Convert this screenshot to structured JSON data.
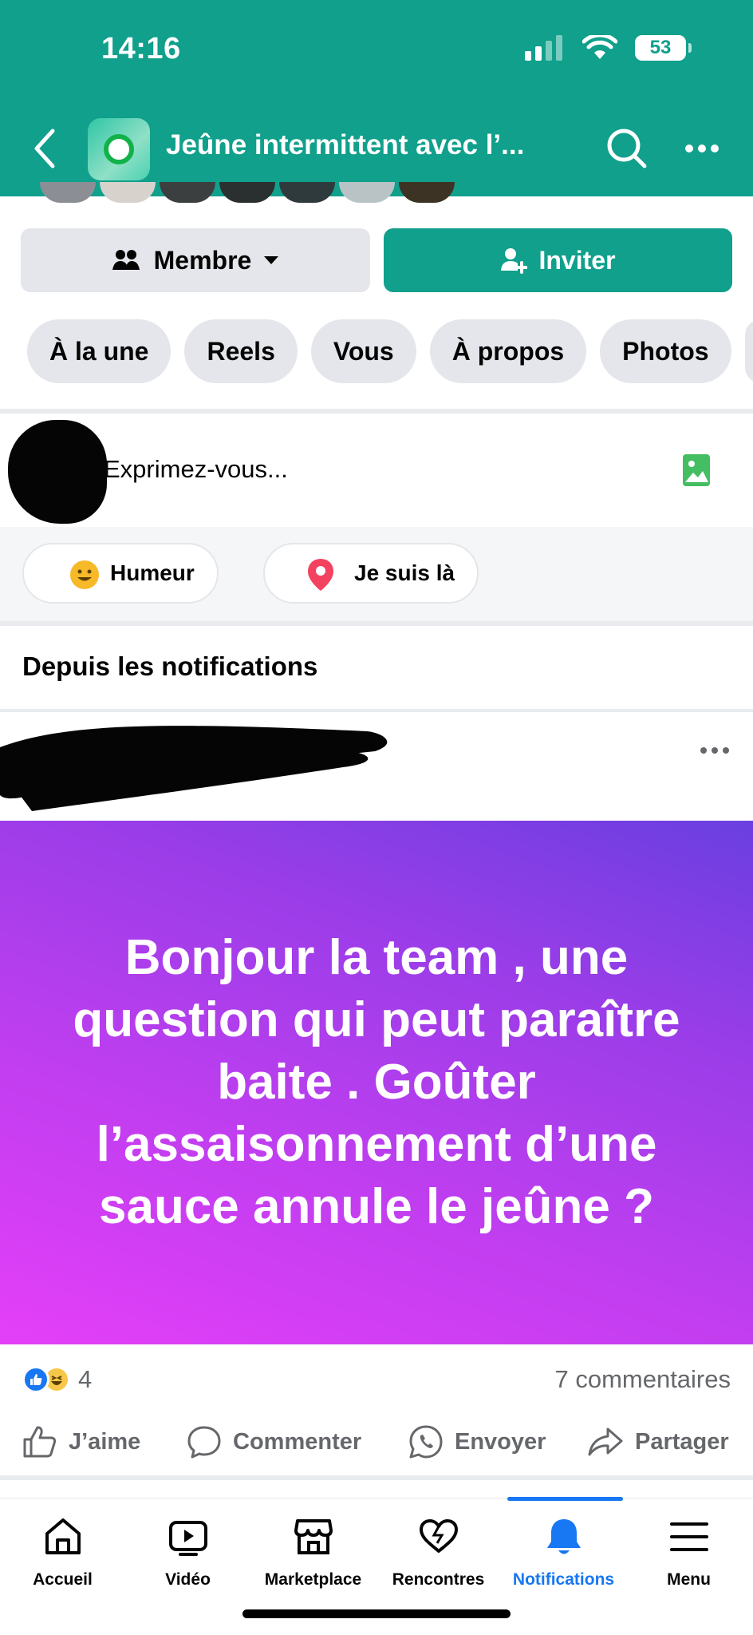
{
  "status_bar": {
    "time": "14:16",
    "battery": "53",
    "icons": [
      "signal-icon",
      "wifi-icon",
      "battery-icon"
    ]
  },
  "header": {
    "title": "Jeûne intermittent avec l’...",
    "back_icon": "chevron-left-icon",
    "search_icon": "search-icon",
    "more_icon": "more-icon"
  },
  "actions": {
    "member_label": "Membre",
    "invite_label": "Inviter"
  },
  "tabs": [
    "À la une",
    "Reels",
    "Vous",
    "À propos",
    "Photos"
  ],
  "composer": {
    "placeholder": "Exprimez-vous...",
    "chips": [
      {
        "label": "Humeur",
        "icon": "smiley-icon"
      },
      {
        "label": "Je suis là",
        "icon": "location-pin-icon"
      }
    ]
  },
  "section_title": "Depuis les notifications",
  "post": {
    "text": "Bonjour la team , une question qui peut paraître baite . Goûter l’assaisonnement d’une sauce annule le jeûne ?",
    "reaction_count": "4",
    "comments": "7 commentaires",
    "buttons": {
      "like": "J’aime",
      "comment": "Commenter",
      "send": "Envoyer",
      "share": "Partager"
    }
  },
  "bottom_nav": [
    {
      "label": "Accueil",
      "icon": "home-icon"
    },
    {
      "label": "Vidéo",
      "icon": "video-icon"
    },
    {
      "label": "Marketplace",
      "icon": "marketplace-icon"
    },
    {
      "label": "Rencontres",
      "icon": "heart-icon"
    },
    {
      "label": "Notifications",
      "icon": "bell-icon",
      "active": true
    },
    {
      "label": "Menu",
      "icon": "menu-icon"
    }
  ],
  "colors": {
    "brand": "#10a08c",
    "active_nav": "#1877f2",
    "post_gradient_start": "#6a3fe0",
    "post_gradient_end": "#e43ff8"
  }
}
